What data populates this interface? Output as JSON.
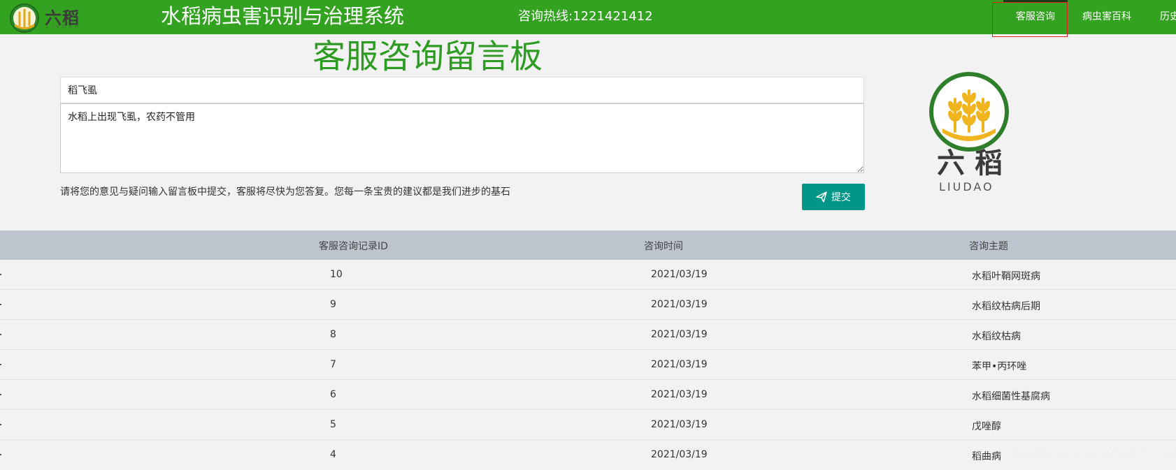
{
  "header": {
    "logo_text": "六稻",
    "logo_sub": "LIUDAO",
    "site_title": "水稻病虫害识别与治理系统",
    "hotline": "咨询热线:1221421412",
    "nav": [
      {
        "label": "客服咨询",
        "active": true
      },
      {
        "label": "病虫害百科",
        "active": false
      },
      {
        "label": "历史",
        "active": false
      }
    ]
  },
  "board": {
    "title": "客服咨询留言板"
  },
  "form": {
    "subject_value": "稻飞虱",
    "content_value": "水稻上出现飞虱，农药不管用",
    "hint": "请将您的意见与疑问输入留言板中提交，客服将尽快为您答复。您每一条宝贵的建议都是我们进步的基石",
    "submit_label": "提交"
  },
  "logo_big": {
    "text": "六稻",
    "sub": "LIUDAO"
  },
  "table": {
    "headers": [
      "客服咨询记录ID",
      "咨询时间",
      "咨询主题"
    ],
    "rows": [
      {
        "id": "10",
        "time": "2021/03/19",
        "topic": "水稻叶鞘网斑病"
      },
      {
        "id": "9",
        "time": "2021/03/19",
        "topic": "水稻纹枯病后期"
      },
      {
        "id": "8",
        "time": "2021/03/19",
        "topic": "水稻纹枯病"
      },
      {
        "id": "7",
        "time": "2021/03/19",
        "topic": "苯甲•丙环唑"
      },
      {
        "id": "6",
        "time": "2021/03/19",
        "topic": "水稻细菌性基腐病"
      },
      {
        "id": "5",
        "time": "2021/03/19",
        "topic": "戊唑醇"
      },
      {
        "id": "4",
        "time": "2021/03/19",
        "topic": "稻曲病"
      }
    ]
  },
  "watermark": "https://blog.csdn.net/weixin_43323146",
  "colors": {
    "header_bg": "#34a221",
    "title_green": "#2e9b23",
    "button_teal": "#009688",
    "table_header_bg": "#bec4cd"
  }
}
